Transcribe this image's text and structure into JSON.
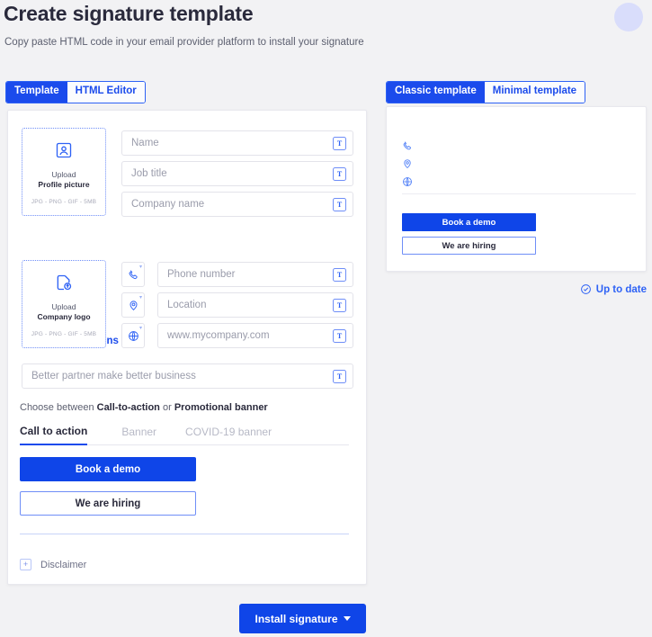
{
  "header": {
    "title": "Create signature template",
    "subtitle": "Copy paste HTML code in your email provider platform to install your signature",
    "avatar": "avatar-placeholder"
  },
  "editor_toggle": {
    "options": [
      "Template",
      "HTML Editor"
    ],
    "selected": "Template"
  },
  "preview_toggle": {
    "options": [
      "Classic template",
      "Minimal template"
    ],
    "selected": "Classic template"
  },
  "form": {
    "profile_upload": {
      "icon": "user-avatar-icon",
      "line1": "Upload",
      "line2": "Profile picture",
      "constraints": "JPG - PNG - GIF - 5MB"
    },
    "logo_upload": {
      "icon": "image-upload-icon",
      "line1": "Upload",
      "line2": "Company logo",
      "constraints": "JPG - PNG - GIF - 5MB"
    },
    "add_social_label": "+ Add social icons",
    "identity_fields": [
      {
        "name": "name",
        "placeholder": "Name",
        "value": ""
      },
      {
        "name": "job-title",
        "placeholder": "Job title",
        "value": ""
      },
      {
        "name": "company-name",
        "placeholder": "Company name",
        "value": ""
      }
    ],
    "contact_fields": [
      {
        "name": "phone",
        "icon": "phone-icon",
        "placeholder": "Phone number",
        "value": ""
      },
      {
        "name": "location",
        "icon": "location-pin-icon",
        "placeholder": "Location",
        "value": ""
      },
      {
        "name": "website",
        "icon": "globe-icon",
        "placeholder": "www.mycompany.com",
        "value": ""
      }
    ],
    "tagline_field": {
      "placeholder": "Better partner make better business",
      "value": ""
    },
    "format_button_label": "T",
    "choose_text_prefix": "Choose between ",
    "choose_text_strong1": "Call-to-action",
    "choose_text_middle": " or ",
    "choose_text_strong2": "Promotional banner",
    "tabs": [
      {
        "label": "Call to action",
        "active": true
      },
      {
        "label": "Banner",
        "active": false
      },
      {
        "label": "COVID-19 banner",
        "active": false
      }
    ],
    "cta_primary": "Book a demo",
    "cta_secondary": "We are hiring",
    "disclaimer": {
      "toggle": "+",
      "label": "Disclaimer"
    }
  },
  "preview": {
    "contact_icons": [
      "phone-icon",
      "location-pin-icon",
      "globe-icon"
    ],
    "cta_primary": "Book a demo",
    "cta_secondary": "We are hiring"
  },
  "status": {
    "icon": "check-circle-icon",
    "label": "Up to date"
  },
  "footer": {
    "install_label": "Install signature",
    "caret": "chevron-down-icon"
  },
  "colors": {
    "accent": "#1b4bec",
    "button": "#0f45e8",
    "page_bg": "#f2f2f4",
    "avatar": "#d9ddfb"
  }
}
